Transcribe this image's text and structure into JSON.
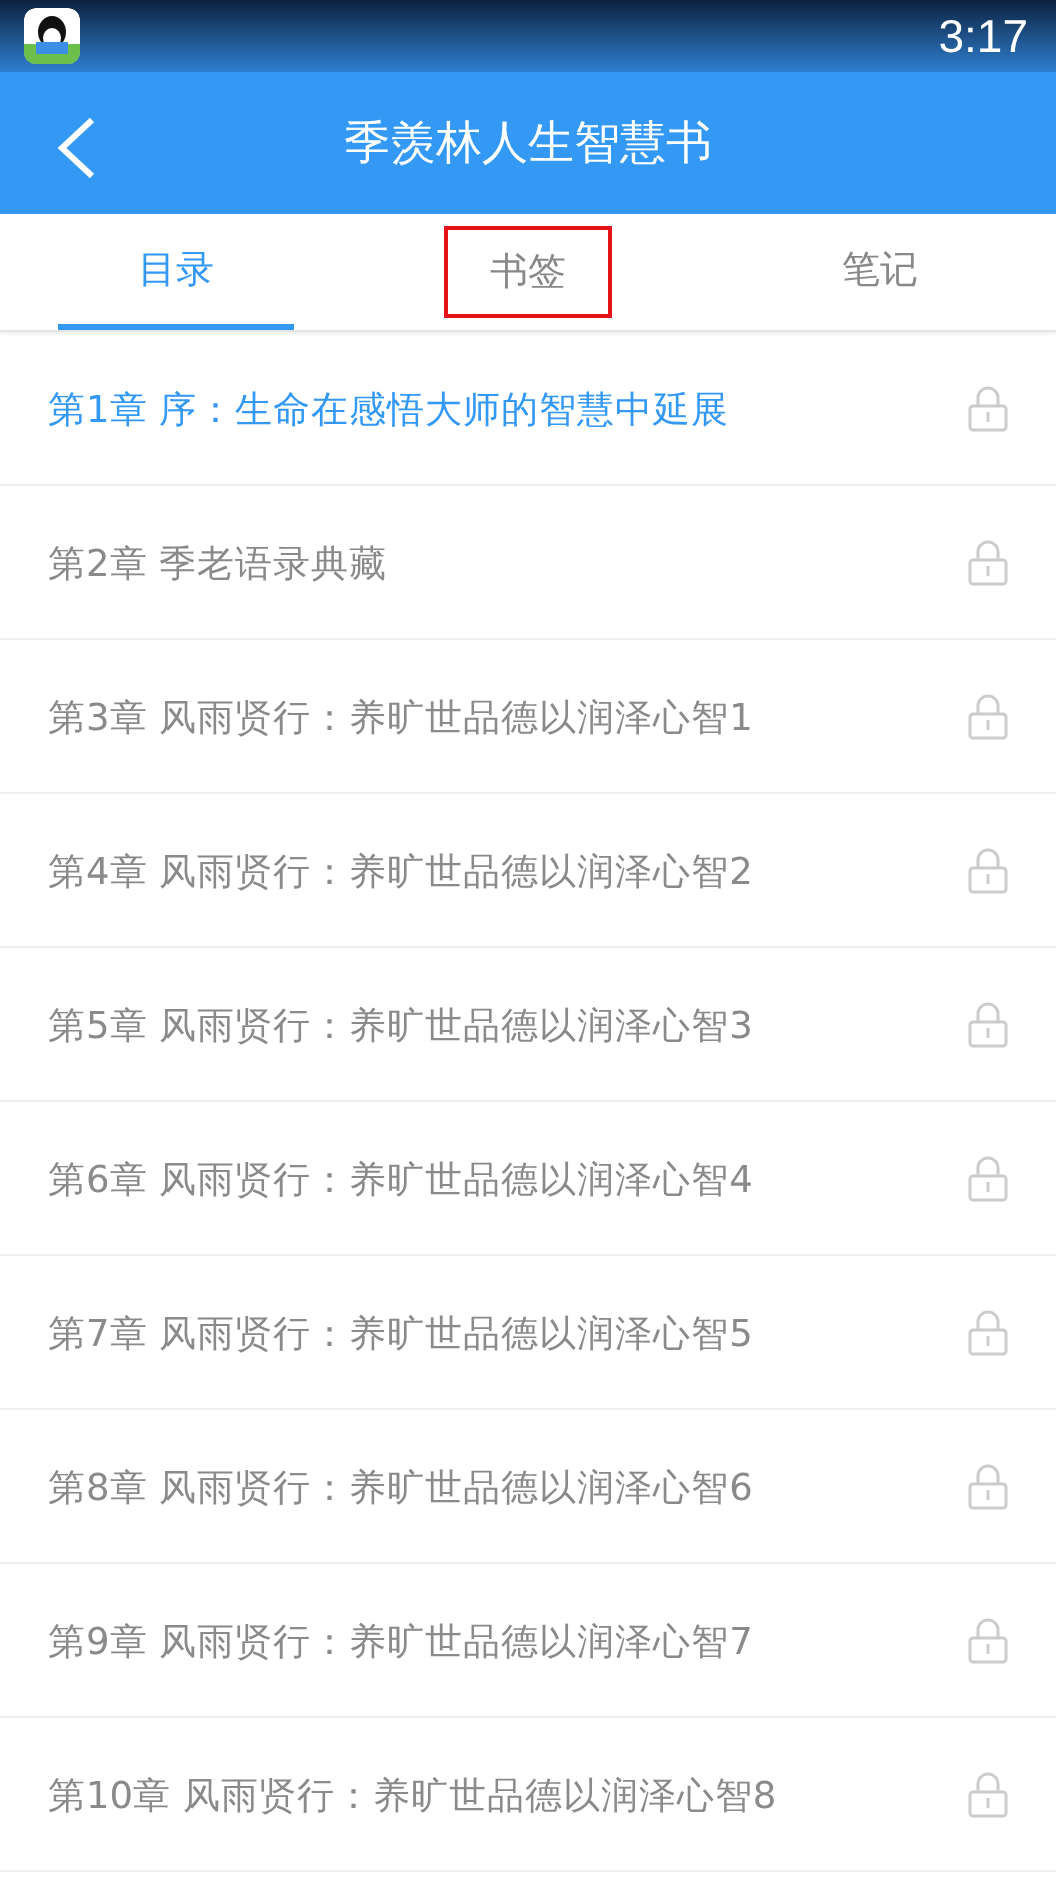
{
  "status_bar": {
    "time": "3:17"
  },
  "header": {
    "title": "季羡林人生智慧书"
  },
  "tabs": [
    {
      "label": "目录",
      "selected": true,
      "highlighted": false
    },
    {
      "label": "书签",
      "selected": false,
      "highlighted": true
    },
    {
      "label": "笔记",
      "selected": false,
      "highlighted": false
    }
  ],
  "chapters": [
    {
      "title": "第1章 序：生命在感悟大师的智慧中延展",
      "current": true,
      "locked": true
    },
    {
      "title": "第2章 季老语录典藏",
      "current": false,
      "locked": true
    },
    {
      "title": "第3章 风雨贤行：养旷世品德以润泽心智1",
      "current": false,
      "locked": true
    },
    {
      "title": "第4章 风雨贤行：养旷世品德以润泽心智2",
      "current": false,
      "locked": true
    },
    {
      "title": "第5章 风雨贤行：养旷世品德以润泽心智3",
      "current": false,
      "locked": true
    },
    {
      "title": "第6章 风雨贤行：养旷世品德以润泽心智4",
      "current": false,
      "locked": true
    },
    {
      "title": "第7章 风雨贤行：养旷世品德以润泽心智5",
      "current": false,
      "locked": true
    },
    {
      "title": "第8章 风雨贤行：养旷世品德以润泽心智6",
      "current": false,
      "locked": true
    },
    {
      "title": "第9章 风雨贤行：养旷世品德以润泽心智7",
      "current": false,
      "locked": true
    },
    {
      "title": "第10章 风雨贤行：养旷世品德以润泽心智8",
      "current": false,
      "locked": true
    }
  ]
}
